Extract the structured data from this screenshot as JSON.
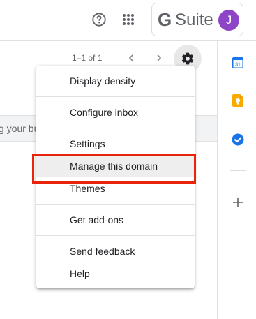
{
  "header": {
    "help_icon": "help-circle-icon",
    "apps_icon": "apps-grid-icon",
    "brand_g": "G",
    "brand_word": "Suite",
    "avatar_initial": "J",
    "avatar_color": "#8e44c7"
  },
  "toolbar": {
    "pagination": "1–1 of 1",
    "prev_icon": "chevron-left-icon",
    "next_icon": "chevron-right-icon",
    "settings_icon": "gear-icon"
  },
  "notice": {
    "text": "g your bu"
  },
  "side_panel": {
    "calendar_day": "31",
    "icons": [
      "calendar-icon",
      "keep-icon",
      "tasks-icon",
      "add-icon"
    ]
  },
  "menu": {
    "items": [
      {
        "label": "Display density"
      },
      {
        "label": "Configure inbox"
      },
      {
        "label": "Settings"
      },
      {
        "label": "Manage this domain"
      },
      {
        "label": "Themes"
      },
      {
        "label": "Get add-ons"
      },
      {
        "label": "Send feedback"
      },
      {
        "label": "Help"
      }
    ],
    "highlighted_index": 3,
    "highlight_outline_color": "#e8240a"
  }
}
